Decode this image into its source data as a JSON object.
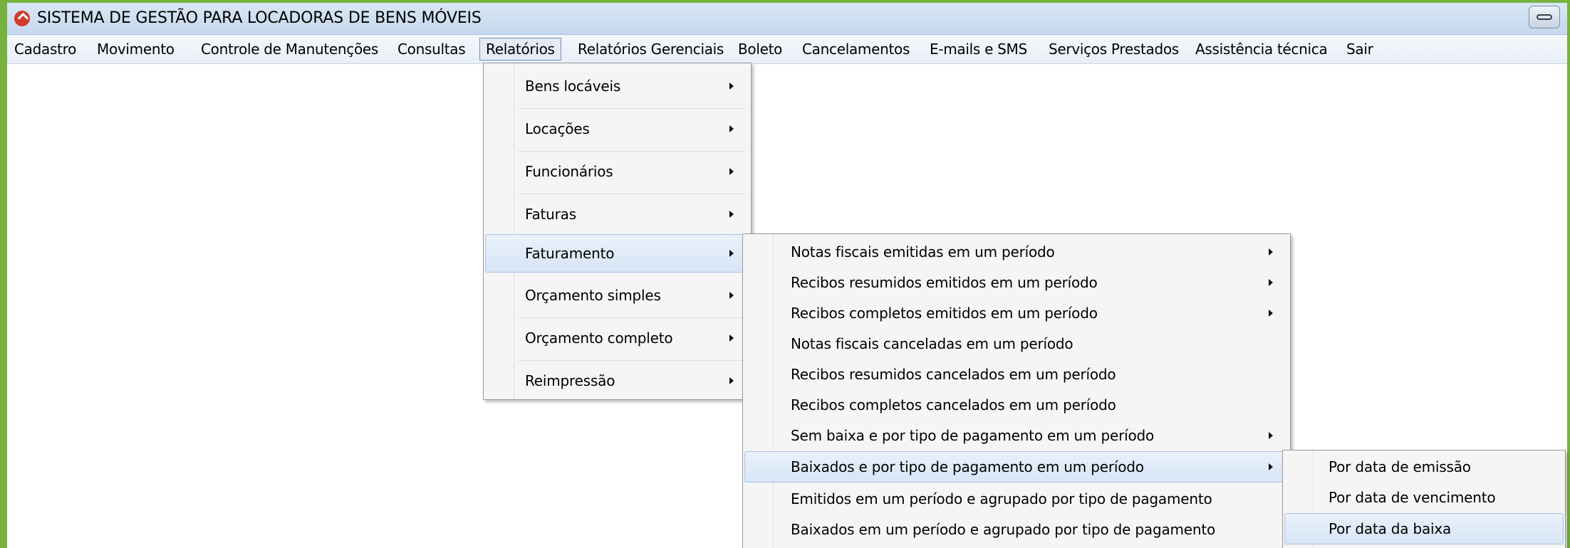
{
  "window": {
    "title": "SISTEMA DE GESTÃO PARA LOCADORAS DE BENS MÓVEIS",
    "accent": "#77b23f"
  },
  "menubar": {
    "items": [
      {
        "label": "Cadastro"
      },
      {
        "label": "Movimento"
      },
      {
        "label": "Controle de Manutenções"
      },
      {
        "label": "Consultas"
      },
      {
        "label": "Relatórios"
      },
      {
        "label": "Relatórios Gerenciais"
      },
      {
        "label": "Boleto"
      },
      {
        "label": "Cancelamentos"
      },
      {
        "label": "E-mails e SMS"
      },
      {
        "label": "Serviços Prestados"
      },
      {
        "label": "Assistência técnica"
      },
      {
        "label": "Sair"
      }
    ]
  },
  "relatorios_menu": {
    "items": [
      {
        "label": "Bens locáveis"
      },
      {
        "label": "Locações"
      },
      {
        "label": "Funcionários"
      },
      {
        "label": "Faturas"
      },
      {
        "label": "Faturamento"
      },
      {
        "label": "Orçamento simples"
      },
      {
        "label": "Orçamento completo"
      },
      {
        "label": "Reimpressão"
      }
    ]
  },
  "faturamento_menu": {
    "items": [
      {
        "label": "Notas fiscais emitidas em um período"
      },
      {
        "label": "Recibos resumidos emitidos em um período"
      },
      {
        "label": "Recibos completos emitidos em um período"
      },
      {
        "label": "Notas fiscais canceladas em um período"
      },
      {
        "label": "Recibos resumidos cancelados em um período"
      },
      {
        "label": "Recibos completos cancelados em um período"
      },
      {
        "label": "Sem baixa e por tipo de pagamento em um período"
      },
      {
        "label": "Baixados e por tipo de pagamento em um período"
      },
      {
        "label": "Emitidos em um período e agrupado por tipo de pagamento"
      },
      {
        "label": "Baixados em um período e agrupado por tipo de pagamento"
      }
    ]
  },
  "baixados_menu": {
    "items": [
      {
        "label": "Por data de emissão"
      },
      {
        "label": "Por data de vencimento"
      },
      {
        "label": "Por data da baixa"
      }
    ]
  }
}
